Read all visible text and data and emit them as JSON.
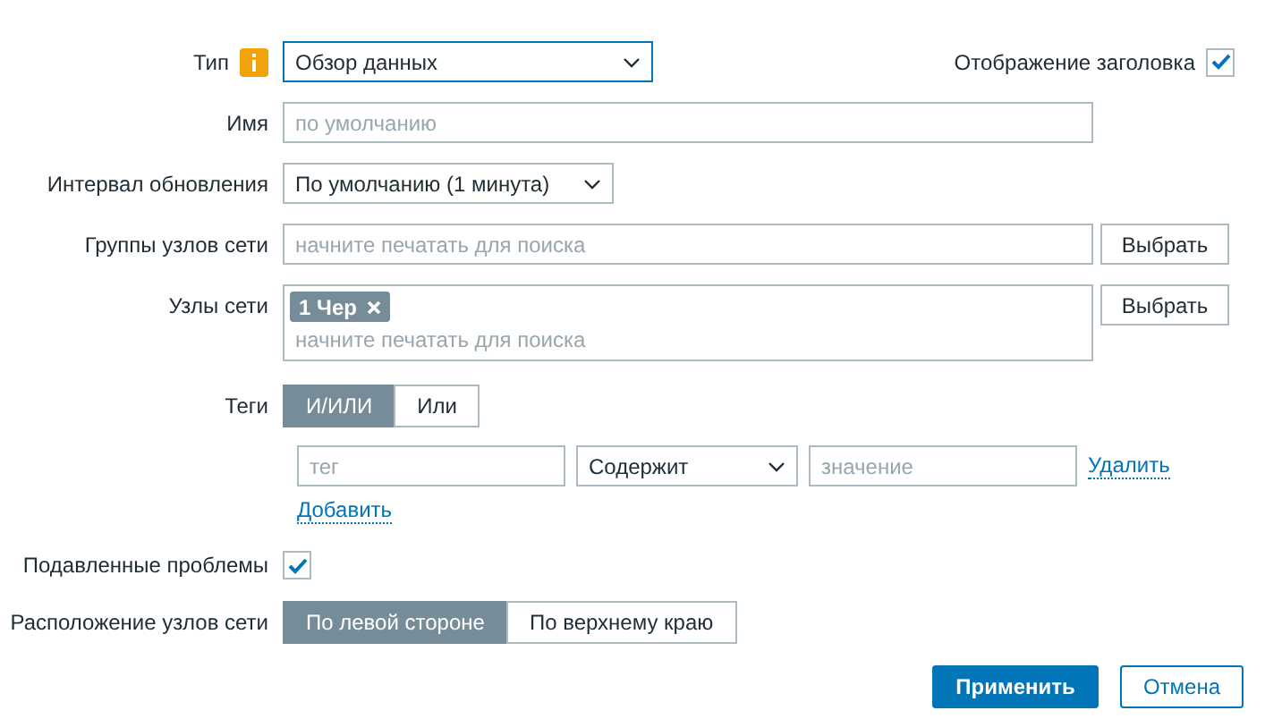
{
  "type": {
    "label": "Тип",
    "value": "Обзор данных"
  },
  "show_header": {
    "label": "Отображение заголовка",
    "checked": true
  },
  "name": {
    "label": "Имя",
    "placeholder": "по умолчанию"
  },
  "refresh_interval": {
    "label": "Интервал обновления",
    "value": "По умолчанию (1 минута)"
  },
  "host_groups": {
    "label": "Группы узлов сети",
    "placeholder": "начните печатать для поиска",
    "button": "Выбрать"
  },
  "hosts": {
    "label": "Узлы сети",
    "chips": [
      {
        "text": "1 Чер"
      }
    ],
    "placeholder": "начните печатать для поиска",
    "button": "Выбрать"
  },
  "tags": {
    "label": "Теги",
    "operators": [
      {
        "label": "И/ИЛИ",
        "selected": true
      },
      {
        "label": "Или",
        "selected": false
      }
    ],
    "rows": [
      {
        "tag_placeholder": "тег",
        "operator": "Содержит",
        "value_placeholder": "значение",
        "remove": "Удалить"
      }
    ],
    "add": "Добавить"
  },
  "suppressed": {
    "label": "Подавленные проблемы",
    "checked": true
  },
  "host_location": {
    "label": "Расположение узлов сети",
    "options": [
      {
        "label": "По левой стороне",
        "selected": true
      },
      {
        "label": "По верхнему краю",
        "selected": false
      }
    ]
  },
  "buttons": [
    {
      "label": "Применить",
      "kind": "primary"
    },
    {
      "label": "Отмена",
      "kind": "secondary"
    }
  ]
}
